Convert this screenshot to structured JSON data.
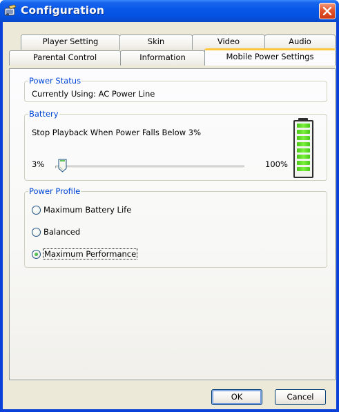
{
  "window": {
    "title": "Configuration"
  },
  "tabs": {
    "row_back": [
      "Player Setting",
      "Skin",
      "Video",
      "Audio"
    ],
    "row_front": [
      "Parental Control",
      "Information",
      "Mobile Power Settings"
    ],
    "active": "Mobile Power Settings"
  },
  "power_status": {
    "legend": "Power Status",
    "text": "Currently Using: AC Power Line"
  },
  "battery": {
    "legend": "Battery",
    "stop_text": "Stop Playback When Power Falls Below  3%",
    "slider_min_label": "3%",
    "slider_max_label": "100%",
    "slider_value_percent": 3,
    "battery_level_fraction": 1.0
  },
  "power_profile": {
    "legend": "Power Profile",
    "options": [
      "Maximum Battery Life",
      "Balanced",
      "Maximum Performance"
    ],
    "selected": "Maximum Performance"
  },
  "buttons": {
    "ok": "OK",
    "cancel": "Cancel"
  },
  "colors": {
    "titlebar": "#0553e2",
    "legend_text": "#0046d5",
    "active_tab_accent": "#ffc83c",
    "battery_cell": "#48c818",
    "close": "#e4542b"
  },
  "icons": {
    "app": "configuration-app-icon",
    "close": "close-icon"
  }
}
